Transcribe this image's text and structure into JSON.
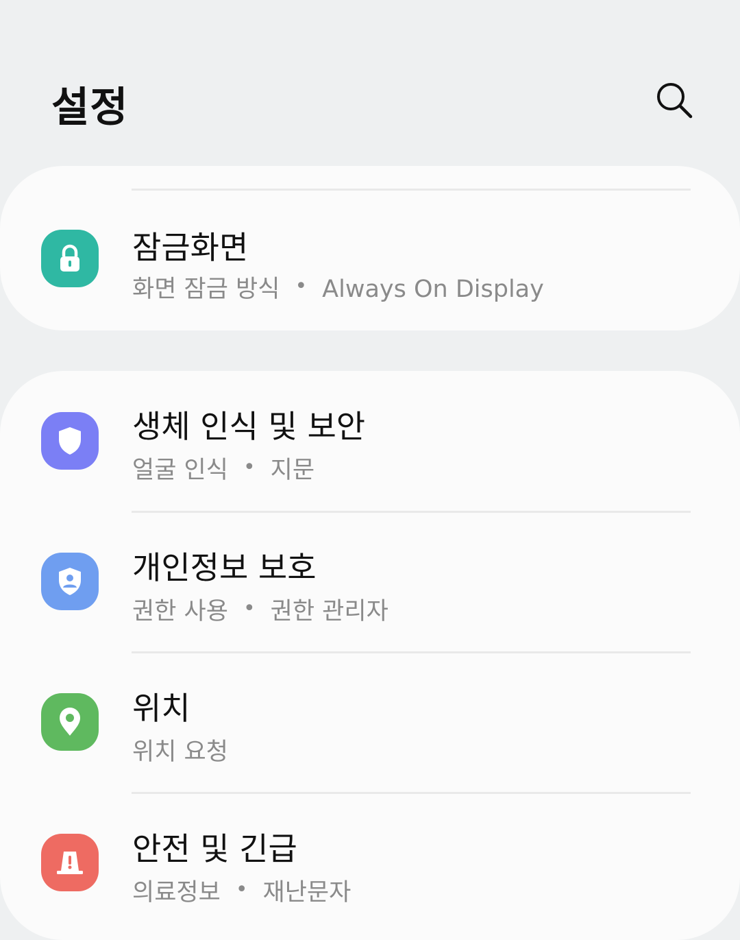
{
  "header": {
    "title": "설정",
    "search_icon": "search-icon"
  },
  "sections": [
    {
      "items": [
        {
          "title": "잠금화면",
          "subtitle": [
            "화면 잠금 방식",
            "Always On Display"
          ],
          "icon": "lock-icon",
          "icon_color": "#2fb8a3"
        }
      ]
    },
    {
      "items": [
        {
          "title": "생체 인식 및 보안",
          "subtitle": [
            "얼굴 인식",
            "지문"
          ],
          "icon": "shield-icon",
          "icon_color": "#7b7ff5"
        },
        {
          "title": "개인정보 보호",
          "subtitle": [
            "권한 사용",
            "권한 관리자"
          ],
          "icon": "privacy-shield-icon",
          "icon_color": "#6f9ef0"
        },
        {
          "title": "위치",
          "subtitle": [
            "위치 요청"
          ],
          "icon": "location-pin-icon",
          "icon_color": "#5fb95f"
        },
        {
          "title": "안전 및 긴급",
          "subtitle": [
            "의료정보",
            "재난문자"
          ],
          "icon": "emergency-alert-icon",
          "icon_color": "#ee6b62"
        }
      ]
    }
  ],
  "subtitle_separator": "•"
}
